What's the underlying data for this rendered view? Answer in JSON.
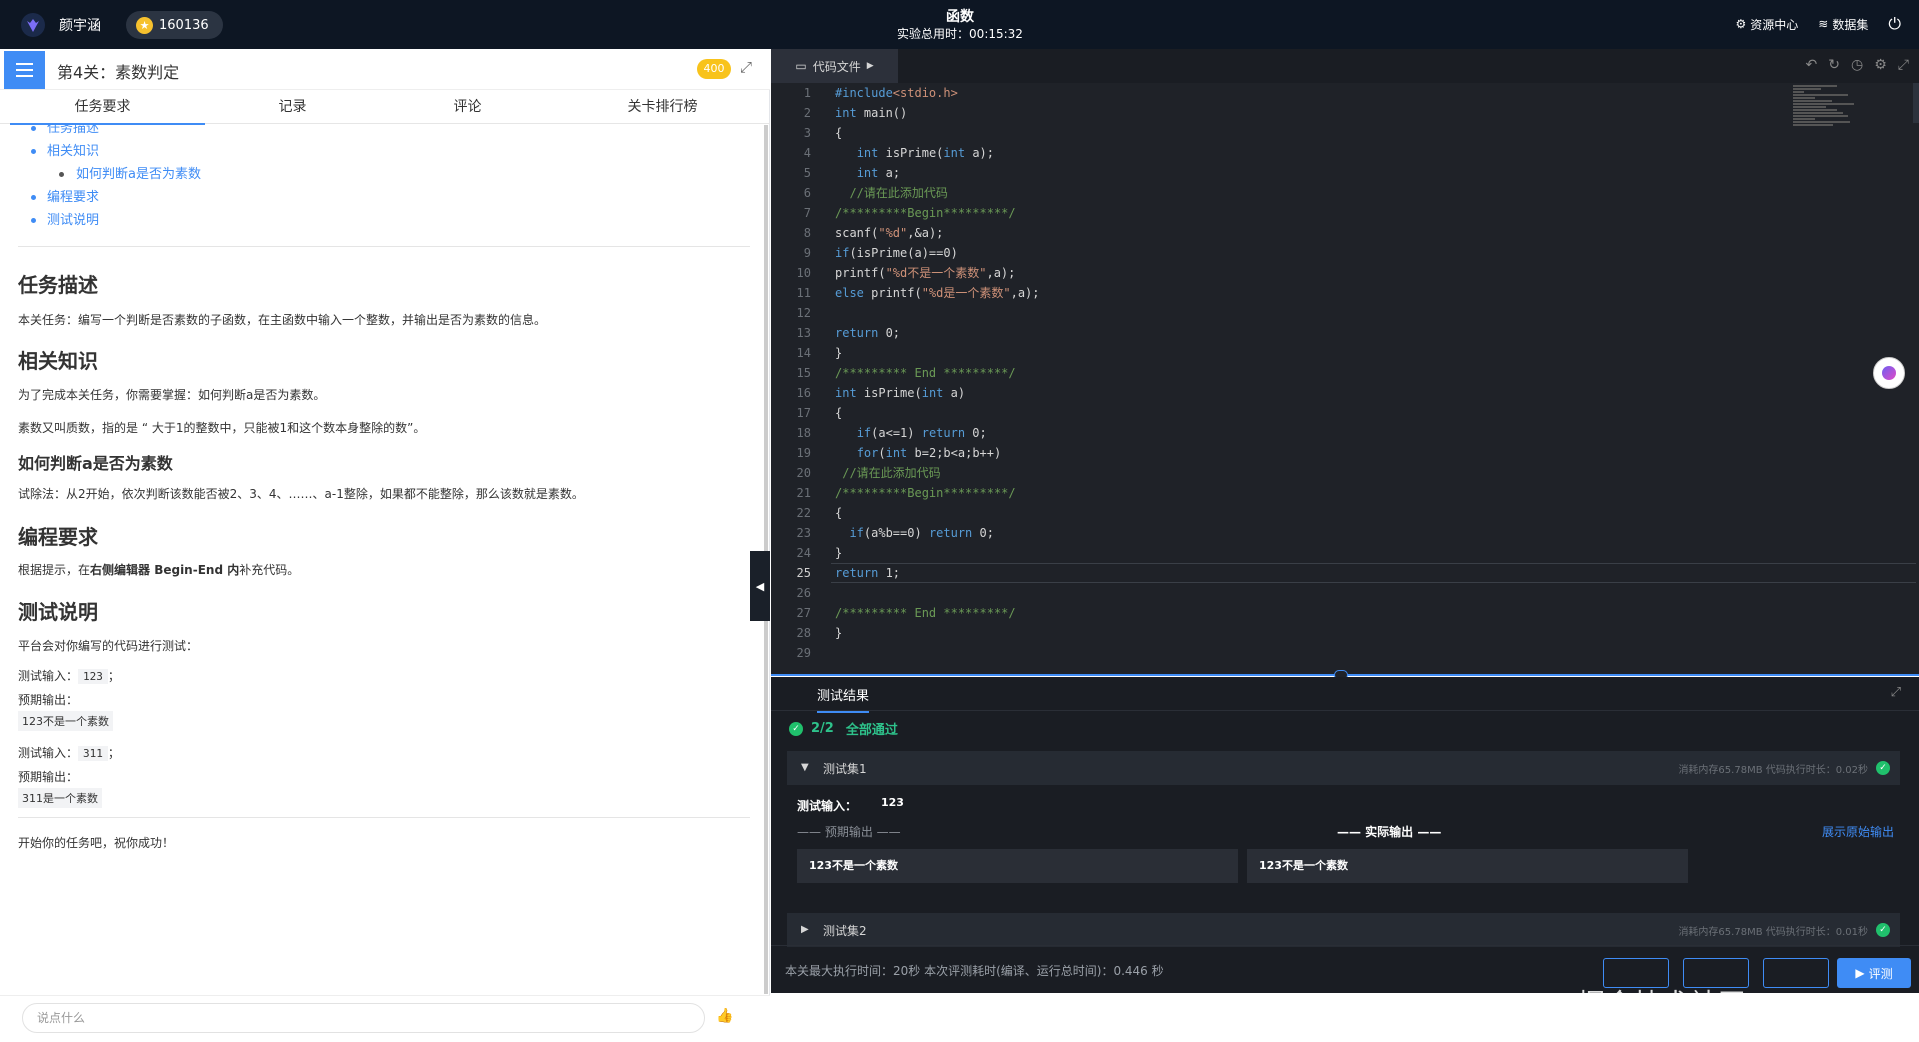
{
  "topbar": {
    "user": "颜宇涵",
    "coins": "160136",
    "title": "函数",
    "time_label": "实验总用时：00:15:32",
    "resource_label": "资源中心",
    "dataset_label": "数据集"
  },
  "left": {
    "title": "第4关：素数判定",
    "badge": "400",
    "tabs": [
      "任务要求",
      "记录",
      "评论",
      "关卡排行榜"
    ],
    "toc": [
      "任务描述",
      "相关知识",
      "如何判断a是否为素数",
      "编程要求",
      "测试说明"
    ],
    "h_task": "任务描述",
    "p_task": "本关任务：编写一个判断是否素数的子函数，在主函数中输入一个整数，并输出是否为素数的信息。",
    "h_know": "相关知识",
    "p_know1": "为了完成本关任务，你需要掌握：如何判断a是否为素数。",
    "p_know2": "素数又叫质数，指的是 “ 大于1的整数中，只能被1和这个数本身整除的数”。",
    "h_judge": "如何判断a是否为素数",
    "p_judge": "试除法：从2开始，依次判断该数能否被2、3、4、……、a-1整除，如果都不能整除，那么该数就是素数。",
    "h_req": "编程要求",
    "p_req_pre": "根据提示，在",
    "p_req_bold": "右侧编辑器 Begin-End 内",
    "p_req_post": "补充代码。",
    "h_test": "测试说明",
    "p_test": "平台会对你编写的代码进行测试：",
    "test_input_label": "测试输入：",
    "expected_label": "预期输出：",
    "semicolon": "；",
    "test1_in": "123",
    "test1_out": "123不是一个素数",
    "test2_in": "311",
    "test2_out": "311是一个素数",
    "p_end": "开始你的任务吧，祝你成功！",
    "comment_placeholder": "说点什么"
  },
  "editor": {
    "tab": "代码文件",
    "current_line": 25
  },
  "results": {
    "tab": "测试结果",
    "summary_count": "2/2",
    "summary_text": "全部通过",
    "set1_name": "测试集1",
    "set1_meta": "消耗内存65.78MB    代码执行时长：0.02秒",
    "input_label": "测试输入：",
    "input_value": "123",
    "expected_label": "—— 预期输出 ——",
    "actual_label": "—— 实际输出 ——",
    "raw_label": "展示原始输出",
    "expected_value": "123不是一个素数",
    "actual_value": "123不是一个素数",
    "set2_name": "测试集2",
    "set2_meta": "消耗内存65.78MB    代码执行时长：0.01秒",
    "footer": "本关最大执行时间：20秒    本次评测耗时(编译、运行总时间)：0.446 秒",
    "eval_button": "评测"
  },
  "watermark": "掘金技术社区 @Rossy_Yan",
  "colors": {
    "accent": "#3f8cf5",
    "success": "#20c06c",
    "topbar": "#0d1623",
    "editor_bg": "#1f2228"
  }
}
